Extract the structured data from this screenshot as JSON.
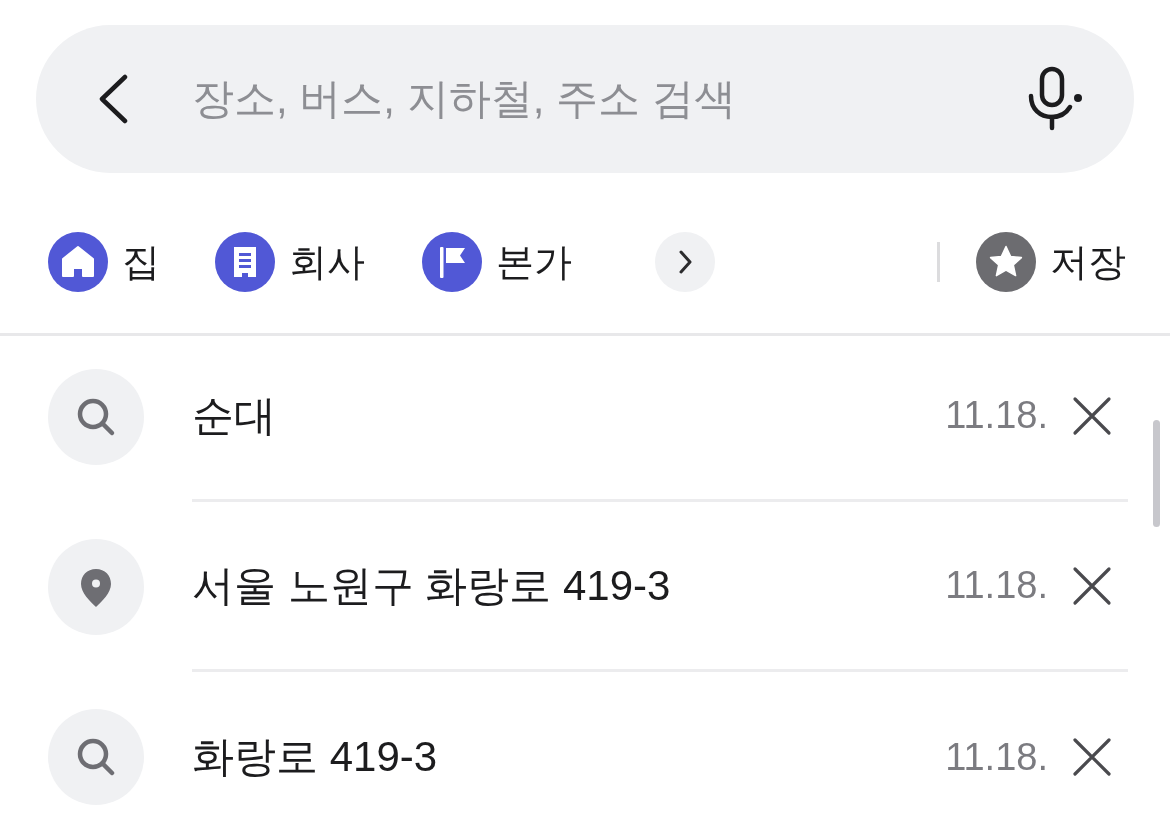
{
  "search": {
    "placeholder": "장소, 버스, 지하철, 주소 검색"
  },
  "shortcuts": [
    {
      "kind": "home",
      "label": "집"
    },
    {
      "kind": "work",
      "label": "회사"
    },
    {
      "kind": "flag",
      "label": "본가"
    }
  ],
  "saved": {
    "label": "저장"
  },
  "history": [
    {
      "kind": "search",
      "text": "순대",
      "date": "11.18."
    },
    {
      "kind": "place",
      "text": "서울 노원구 화랑로 419-3",
      "date": "11.18."
    },
    {
      "kind": "search",
      "text": "화랑로 419-3",
      "date": "11.18."
    }
  ]
}
